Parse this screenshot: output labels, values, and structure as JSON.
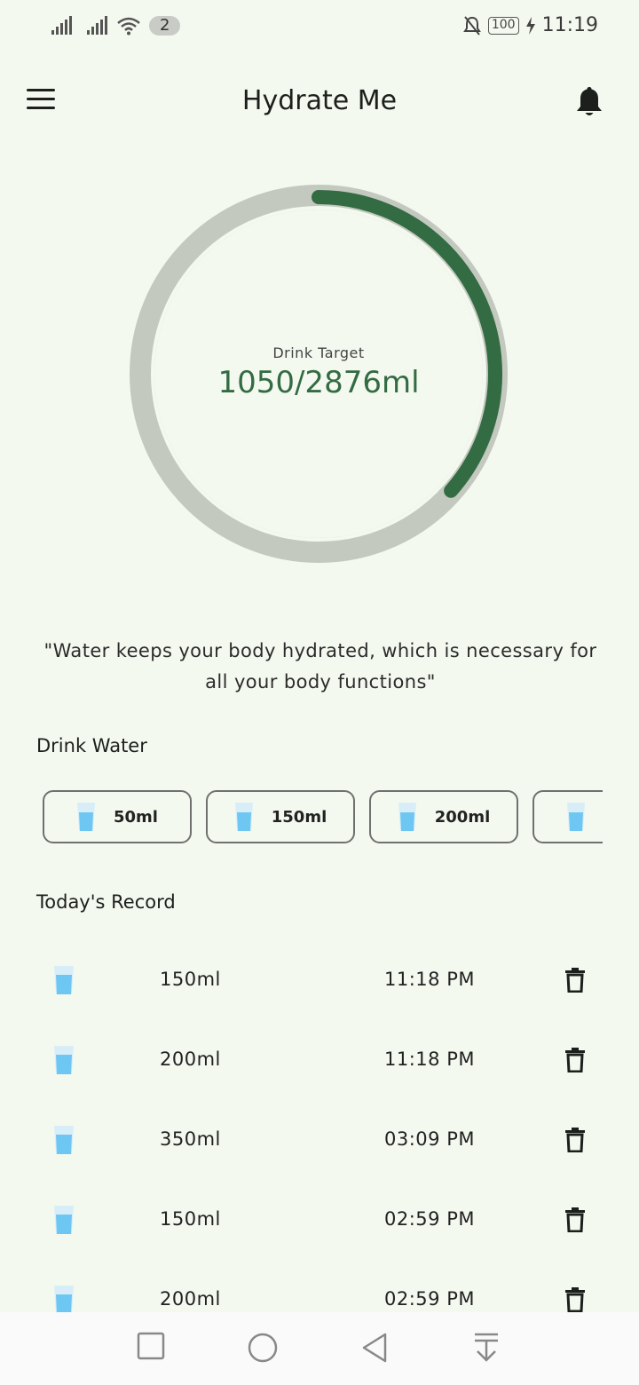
{
  "status_bar": {
    "notification_count": "2",
    "battery": "100",
    "time": "11:19"
  },
  "app_bar": {
    "title": "Hydrate Me",
    "menu_icon": "hamburger-menu-icon",
    "bell_icon": "bell-icon"
  },
  "progress": {
    "label": "Drink Target",
    "value_text": "1050/2876ml",
    "fraction": 0.365,
    "track_color": "#c3c9bf",
    "fill_color": "#336b42"
  },
  "quote": "\"Water keeps your body hydrated, which is necessary for all your body functions\"",
  "drink_water": {
    "title": "Drink Water",
    "options": [
      {
        "label": "50ml"
      },
      {
        "label": "150ml"
      },
      {
        "label": "200ml"
      },
      {
        "label": ""
      }
    ]
  },
  "todays_record": {
    "title": "Today's Record",
    "entries": [
      {
        "amount": "150ml",
        "time": "11:18 PM"
      },
      {
        "amount": "200ml",
        "time": "11:18 PM"
      },
      {
        "amount": "350ml",
        "time": "03:09 PM"
      },
      {
        "amount": "150ml",
        "time": "02:59 PM"
      },
      {
        "amount": "200ml",
        "time": "02:59 PM"
      }
    ]
  },
  "colors": {
    "background": "#f4f9f0",
    "accent": "#336b42",
    "water": "#6ec6f2"
  }
}
